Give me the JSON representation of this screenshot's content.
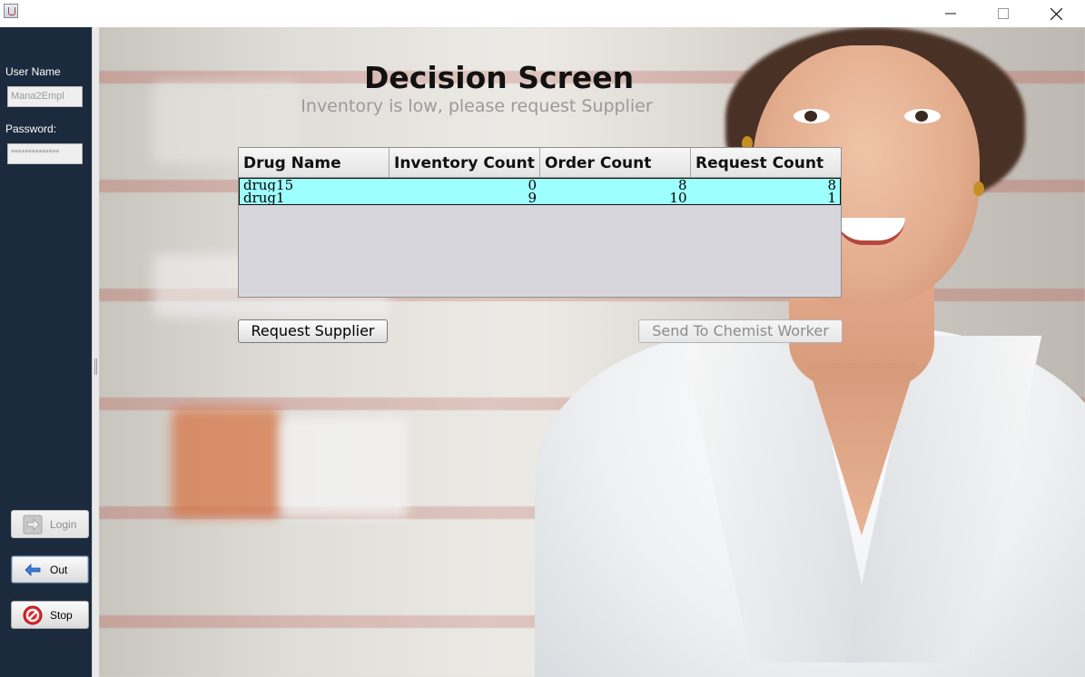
{
  "window": {
    "title": "",
    "controls": {
      "minimize_icon": "minimize-icon",
      "maximize_icon": "maximize-icon",
      "close_icon": "close-icon"
    }
  },
  "sidebar": {
    "username_label": "User Name",
    "username_value": "Mana2Empl",
    "password_label": "Password:",
    "password_value": "**************",
    "buttons": [
      {
        "label": "Login",
        "icon": "arrow-right-icon",
        "enabled": false
      },
      {
        "label": "Out",
        "icon": "arrow-left-icon",
        "enabled": true
      },
      {
        "label": "Stop",
        "icon": "stop-icon",
        "enabled": true
      }
    ]
  },
  "main": {
    "title": "Decision Screen",
    "subtitle": "Inventory is low, please request Supplier",
    "table": {
      "columns": [
        "Drug Name",
        "Inventory Count",
        "Order Count",
        "Request Count"
      ],
      "rows": [
        [
          "drug15",
          "0",
          "8",
          "8"
        ],
        [
          "drug1",
          "9",
          "10",
          "1"
        ]
      ]
    },
    "request_button": "Request Supplier",
    "send_button": "Send To Chemist Worker"
  },
  "colors": {
    "sidebar_bg": "#1b2a3c",
    "row_highlight": "#9effff",
    "disabled_text": "#8c8c8c"
  }
}
